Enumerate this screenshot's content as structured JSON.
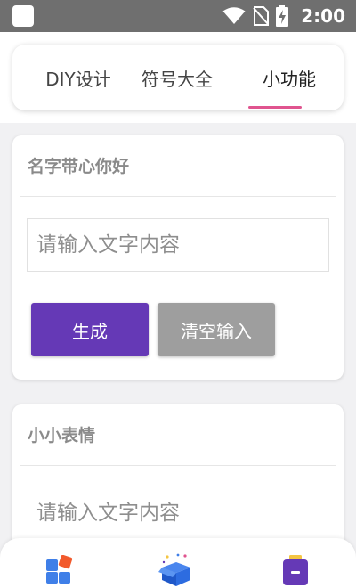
{
  "status_bar": {
    "time": "2:00"
  },
  "tabs": [
    {
      "label": "DIY设计"
    },
    {
      "label": "符号大全"
    },
    {
      "label": "小功能"
    }
  ],
  "cards": [
    {
      "title": "名字带心你好",
      "input_placeholder": "请输入文字内容",
      "input_value": "",
      "generate_label": "生成",
      "clear_label": "清空输入"
    },
    {
      "title": "小小表情",
      "input_placeholder": "请输入文字内容",
      "input_value": ""
    }
  ],
  "bottom_nav": [
    {
      "icon": "diy-blocks-icon"
    },
    {
      "icon": "gift-box-icon"
    },
    {
      "icon": "tool-box-icon"
    }
  ],
  "colors": {
    "accent_purple": "#6539b6",
    "indicator_pink": "#e0548f",
    "button_gray": "#9e9e9e",
    "status_bar": "#6f6f6f"
  }
}
